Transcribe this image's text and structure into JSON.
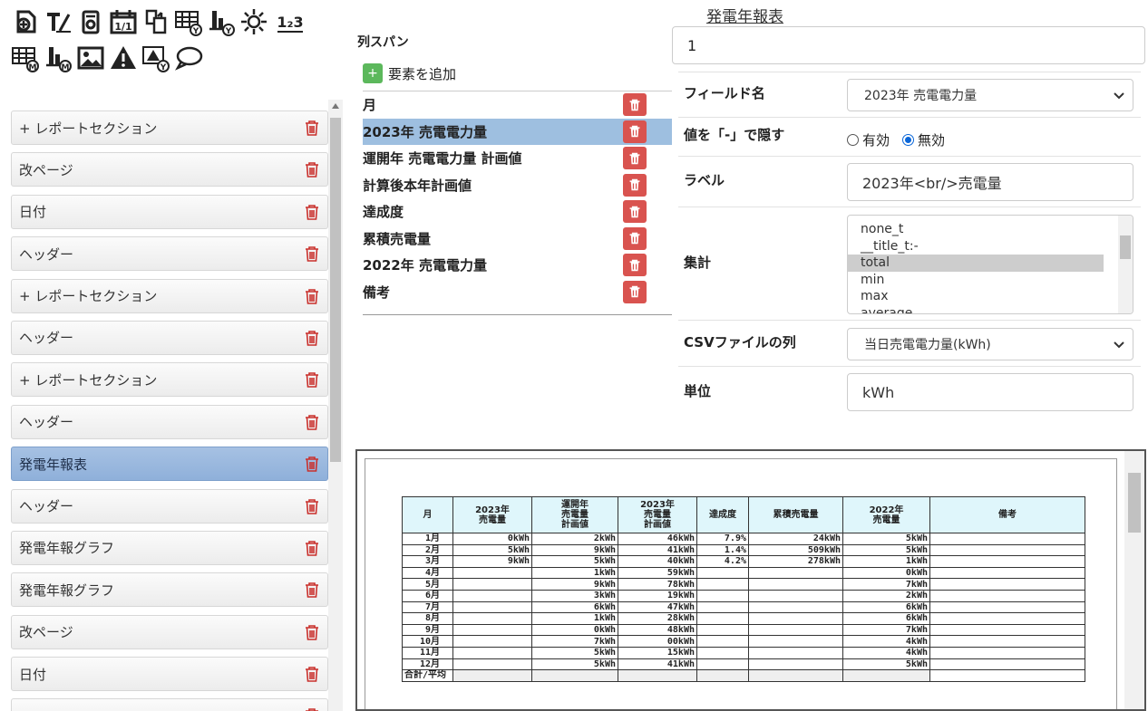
{
  "toolbar": {
    "row1": [
      "add-element-icon",
      "text-icon",
      "cylinder-icon",
      "calendar-icon",
      "copy-icon",
      "table-y-icon",
      "bar-chart-y-icon",
      "sun-icon",
      "numbering-icon"
    ],
    "row2": [
      "table-m-icon",
      "bar-chart-m-icon",
      "image-icon",
      "warning-icon",
      "warning-y-icon",
      "speech-bubble-icon"
    ],
    "calendar_text": "1/1",
    "numbering_text": "1₂3"
  },
  "left_list": [
    {
      "label": "+ レポートセクション",
      "selected": false
    },
    {
      "label": "改ページ",
      "selected": false
    },
    {
      "label": "日付",
      "selected": false
    },
    {
      "label": "ヘッダー",
      "selected": false
    },
    {
      "label": "+ レポートセクション",
      "selected": false
    },
    {
      "label": "ヘッダー",
      "selected": false
    },
    {
      "label": "+ レポートセクション",
      "selected": false
    },
    {
      "label": "ヘッダー",
      "selected": false
    },
    {
      "label": "発電年報表",
      "selected": true
    },
    {
      "label": "ヘッダー",
      "selected": false
    },
    {
      "label": "発電年報グラフ",
      "selected": false
    },
    {
      "label": "発電年報グラフ",
      "selected": false
    },
    {
      "label": "改ページ",
      "selected": false
    },
    {
      "label": "日付",
      "selected": false
    },
    {
      "label": "",
      "selected": false
    }
  ],
  "middle": {
    "title": "列スパン",
    "add_label": "要素を追加",
    "columns": [
      {
        "label": "月",
        "selected": false
      },
      {
        "label": "2023年 売電電力量",
        "selected": true
      },
      {
        "label": "運開年 売電電力量 計画値",
        "selected": false
      },
      {
        "label": "計算後本年計画値",
        "selected": false
      },
      {
        "label": "達成度",
        "selected": false
      },
      {
        "label": "累積売電量",
        "selected": false
      },
      {
        "label": "2022年 売電電力量",
        "selected": false
      },
      {
        "label": "備考",
        "selected": false
      }
    ]
  },
  "right": {
    "report_title": "発電年報表",
    "span_value": "1",
    "field_name_label": "フィールド名",
    "field_name_value": "2023年 売電電力量",
    "hide_label": "値を「-」で隠す",
    "radio_on": "有効",
    "radio_off": "無効",
    "label_label": "ラベル",
    "label_value": "2023年<br/>売電量",
    "agg_label": "集計",
    "agg_options": [
      "none_t",
      "__title_t:-",
      "total",
      "min",
      "max",
      "average"
    ],
    "agg_selected": "total",
    "csv_label": "CSVファイルの列",
    "csv_value": "当日売電電力量(kWh)",
    "unit_label": "単位",
    "unit_value": "kWh"
  },
  "preview": {
    "headers": [
      "月",
      "2023年\n売電量",
      "運開年\n売電量\n計画値",
      "2023年\n売電量\n計画値",
      "達成度",
      "累積売電量",
      "2022年\n売電量",
      "備考"
    ],
    "rows": [
      [
        "1月",
        "0kWh",
        "2kWh",
        "46kWh",
        "7.9%",
        "24kWh",
        "5kWh",
        ""
      ],
      [
        "2月",
        "5kWh",
        "9kWh",
        "41kWh",
        "1.4%",
        "509kWh",
        "5kWh",
        ""
      ],
      [
        "3月",
        "9kWh",
        "5kWh",
        "40kWh",
        "4.2%",
        "278kWh",
        "1kWh",
        ""
      ],
      [
        "4月",
        "",
        "1kWh",
        "59kWh",
        "",
        "",
        "0kWh",
        ""
      ],
      [
        "5月",
        "",
        "9kWh",
        "78kWh",
        "",
        "",
        "7kWh",
        ""
      ],
      [
        "6月",
        "",
        "3kWh",
        "19kWh",
        "",
        "",
        "2kWh",
        ""
      ],
      [
        "7月",
        "",
        "6kWh",
        "47kWh",
        "",
        "",
        "6kWh",
        ""
      ],
      [
        "8月",
        "",
        "1kWh",
        "28kWh",
        "",
        "",
        "6kWh",
        ""
      ],
      [
        "9月",
        "",
        "0kWh",
        "48kWh",
        "",
        "",
        "7kWh",
        ""
      ],
      [
        "10月",
        "",
        "7kWh",
        "00kWh",
        "",
        "",
        "4kWh",
        ""
      ],
      [
        "11月",
        "",
        "5kWh",
        "15kWh",
        "",
        "",
        "4kWh",
        ""
      ],
      [
        "12月",
        "",
        "5kWh",
        "41kWh",
        "",
        "",
        "5kWh",
        ""
      ]
    ],
    "total_label": "合計/平均"
  }
}
